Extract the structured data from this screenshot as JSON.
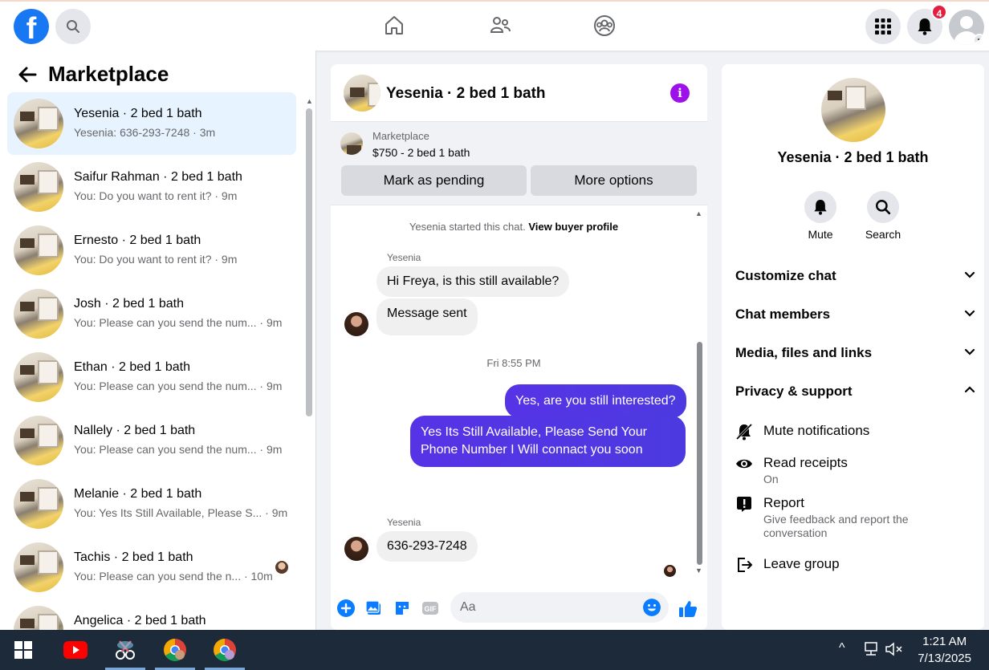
{
  "topbar": {
    "logo": "f",
    "notification_count": "4",
    "icons": [
      "search-icon",
      "home-icon",
      "friends-icon",
      "groups-icon",
      "menu-grid-icon",
      "bell-icon",
      "account-icon"
    ]
  },
  "sidebar": {
    "title": "Marketplace",
    "conversations": [
      {
        "name": "Yesenia · 2 bed 1 bath",
        "preview": "Yesenia: 636-293-7248 · 3m",
        "active": true
      },
      {
        "name": "Saifur Rahman · 2 bed 1 bath",
        "preview": "You: Do you want to rent it? · 9m"
      },
      {
        "name": "Ernesto · 2 bed 1 bath",
        "preview": "You: Do you want to rent it? · 9m"
      },
      {
        "name": "Josh · 2 bed 1 bath",
        "preview": "You: Please can you send the num... · 9m"
      },
      {
        "name": "Ethan · 2 bed 1 bath",
        "preview": "You: Please can you send the num... · 9m"
      },
      {
        "name": "Nallely · 2 bed 1 bath",
        "preview": "You: Please can you send the num... · 9m"
      },
      {
        "name": "Melanie · 2 bed 1 bath",
        "preview": "You: Yes Its Still Available, Please S... · 9m"
      },
      {
        "name": "Tachis · 2 bed 1 bath",
        "preview": "You: Please can you send the n... · 10m"
      },
      {
        "name": "Angelica · 2 bed 1 bath",
        "preview": ""
      }
    ]
  },
  "chat": {
    "title": "Yesenia · 2 bed 1 bath",
    "marketplace_label": "Marketplace",
    "listing": "$750 - 2 bed 1 bath",
    "mark_pending": "Mark as pending",
    "more_options": "More options",
    "started_text": "Yesenia started this chat.",
    "view_profile": "View buyer profile",
    "sender_name": "Yesenia",
    "msg1": "Hi Freya, is this still available?",
    "msg2": "Message sent",
    "timestamp": "Fri 8:55 PM",
    "msg3": "Yes, are you still interested?",
    "msg4": "Yes Its Still Available, Please Send Your Phone Number I Will connact you soon",
    "sender_name2": "Yesenia",
    "msg5": "636-293-7248",
    "input_placeholder": "Aa"
  },
  "details": {
    "title": "Yesenia · 2 bed 1 bath",
    "mute": "Mute",
    "search": "Search",
    "sections": [
      "Customize chat",
      "Chat members",
      "Media, files and links",
      "Privacy & support"
    ],
    "mute_notifications": "Mute notifications",
    "read_receipts": "Read receipts",
    "read_receipts_state": "On",
    "report": "Report",
    "report_desc": "Give feedback and report the conversation",
    "leave_group": "Leave group"
  },
  "taskbar": {
    "time": "1:21 AM",
    "date": "7/13/2025"
  },
  "colors": {
    "brand": "#1877f2",
    "outgoing_bubble": "#5733e6",
    "info": "#9d12e9",
    "badge": "#e41e3f"
  }
}
